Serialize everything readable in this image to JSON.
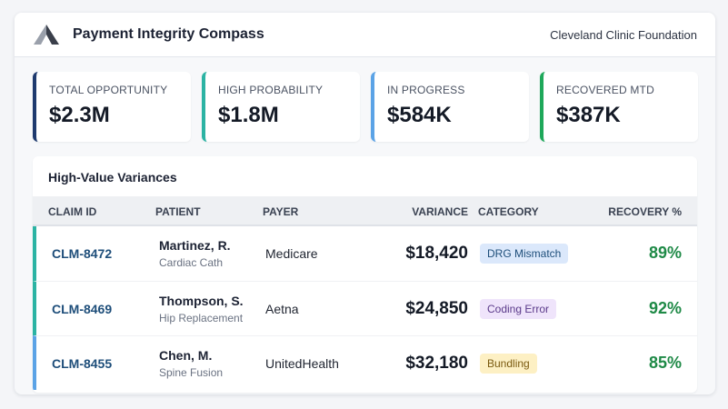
{
  "header": {
    "app_title": "Payment Integrity Compass",
    "organization": "Cleveland Clinic Foundation"
  },
  "kpis": [
    {
      "label": "TOTAL OPPORTUNITY",
      "value": "$2.3M",
      "accent": "#1e3a6e"
    },
    {
      "label": "HIGH PROBABILITY",
      "value": "$1.8M",
      "accent": "#2bb3a3"
    },
    {
      "label": "IN PROGRESS",
      "value": "$584K",
      "accent": "#5ba3e6"
    },
    {
      "label": "RECOVERED MTD",
      "value": "$387K",
      "accent": "#1ea85a"
    }
  ],
  "variances": {
    "title": "High-Value Variances",
    "columns": {
      "claim_id": "CLAIM ID",
      "patient": "PATIENT",
      "payer": "PAYER",
      "variance": "VARIANCE",
      "category": "CATEGORY",
      "recovery": "RECOVERY %"
    },
    "rows": [
      {
        "claim_id": "CLM-8472",
        "patient": "Martinez, R.",
        "procedure": "Cardiac Cath",
        "payer": "Medicare",
        "variance": "$18,420",
        "category": "DRG Mismatch",
        "category_bg": "#dbe8fb",
        "category_fg": "#1e4e7a",
        "recovery": "89%",
        "accent": "#2bb3a3"
      },
      {
        "claim_id": "CLM-8469",
        "patient": "Thompson, S.",
        "procedure": "Hip Replacement",
        "payer": "Aetna",
        "variance": "$24,850",
        "category": "Coding Error",
        "category_bg": "#efe4fb",
        "category_fg": "#5b3a8a",
        "recovery": "92%",
        "accent": "#2bb3a3"
      },
      {
        "claim_id": "CLM-8455",
        "patient": "Chen, M.",
        "procedure": "Spine Fusion",
        "payer": "UnitedHealth",
        "variance": "$32,180",
        "category": "Bundling",
        "category_bg": "#fdf0c4",
        "category_fg": "#7a5a10",
        "recovery": "85%",
        "accent": "#5ba3e6"
      }
    ]
  }
}
